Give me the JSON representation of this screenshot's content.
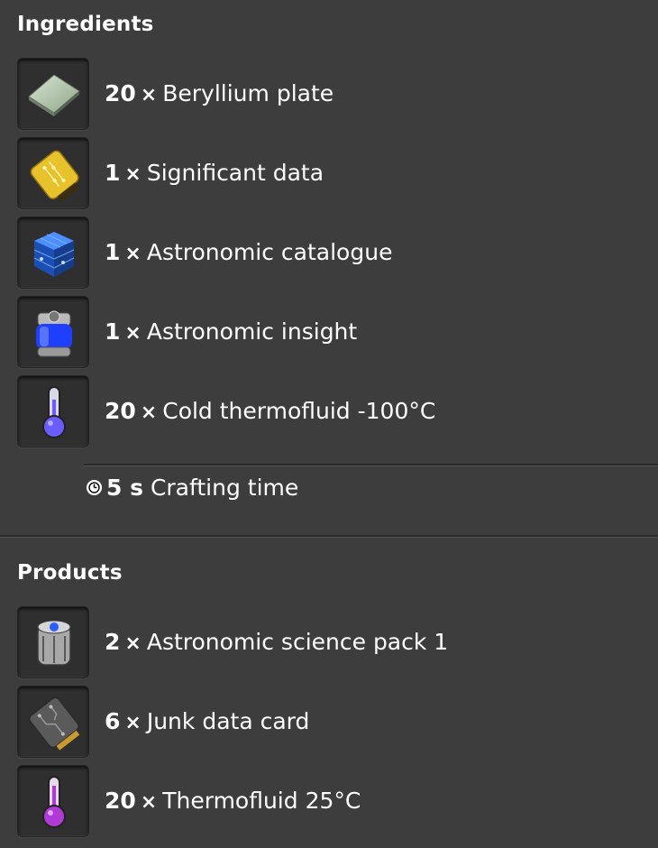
{
  "ingredients": {
    "title": "Ingredients",
    "items": [
      {
        "amount": "20",
        "sep": "×",
        "name": "Beryllium plate",
        "icon": "beryllium-plate-icon"
      },
      {
        "amount": "1",
        "sep": "×",
        "name": "Significant data",
        "icon": "significant-data-icon"
      },
      {
        "amount": "1",
        "sep": "×",
        "name": "Astronomic catalogue",
        "icon": "astronomic-catalogue-icon"
      },
      {
        "amount": "1",
        "sep": "×",
        "name": "Astronomic insight",
        "icon": "astronomic-insight-icon"
      },
      {
        "amount": "20",
        "sep": "×",
        "name": "Cold thermofluid -100°C",
        "icon": "cold-thermofluid-icon"
      }
    ]
  },
  "crafting": {
    "amount": "5 s",
    "label": "Crafting time",
    "icon": "clock-icon"
  },
  "products": {
    "title": "Products",
    "items": [
      {
        "amount": "2",
        "sep": "×",
        "name": "Astronomic science pack 1",
        "icon": "astronomic-science-pack-icon"
      },
      {
        "amount": "6",
        "sep": "×",
        "name": "Junk data card",
        "icon": "junk-data-card-icon"
      },
      {
        "amount": "20",
        "sep": "×",
        "name": "Thermofluid 25°C",
        "icon": "thermofluid-icon"
      }
    ]
  }
}
